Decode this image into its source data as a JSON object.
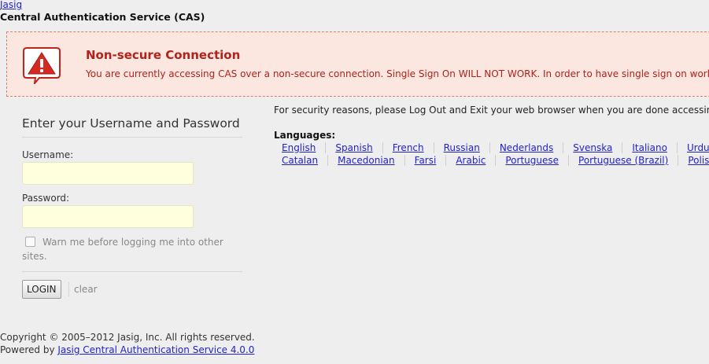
{
  "header": {
    "brand_link": "Jasig",
    "app_title": "Central Authentication Service (CAS)"
  },
  "message": {
    "icon": "warning-triangle-speech-bubble-icon",
    "heading": "Non-secure Connection",
    "text": "You are currently accessing CAS over a non-secure connection. Single Sign On WILL NOT WORK. In order to have single sign on work"
  },
  "login": {
    "heading": "Enter your Username and Password",
    "username_label": "Username:",
    "username_value": "",
    "password_label": "Password:",
    "password_value": "",
    "warn_checked": false,
    "warn_label": "Warn me before logging me into other sites.",
    "submit_label": "LOGIN",
    "clear_label": "clear"
  },
  "sidebar": {
    "security_notice": "For security reasons, please Log Out and Exit your web browser when you are done accessing",
    "languages_label": "Languages:",
    "languages_row1": [
      "English",
      "Spanish",
      "French",
      "Russian",
      "Nederlands",
      "Svenska",
      "Italiano",
      "Urdu"
    ],
    "languages_row2": [
      "Catalan",
      "Macedonian",
      "Farsi",
      "Arabic",
      "Portuguese",
      "Portuguese (Brazil)",
      "Polish"
    ]
  },
  "footer": {
    "copyright": "Copyright © 2005–2012 Jasig, Inc. All rights reserved.",
    "powered_by_prefix": "Powered by ",
    "powered_by_link": "Jasig Central Authentication Service 4.0.0"
  },
  "colors": {
    "background": "#eeeeee",
    "error_background": "#fbe6e0",
    "error_text": "#b0221a",
    "link": "#2222cc",
    "input_background": "#ffffdd"
  }
}
